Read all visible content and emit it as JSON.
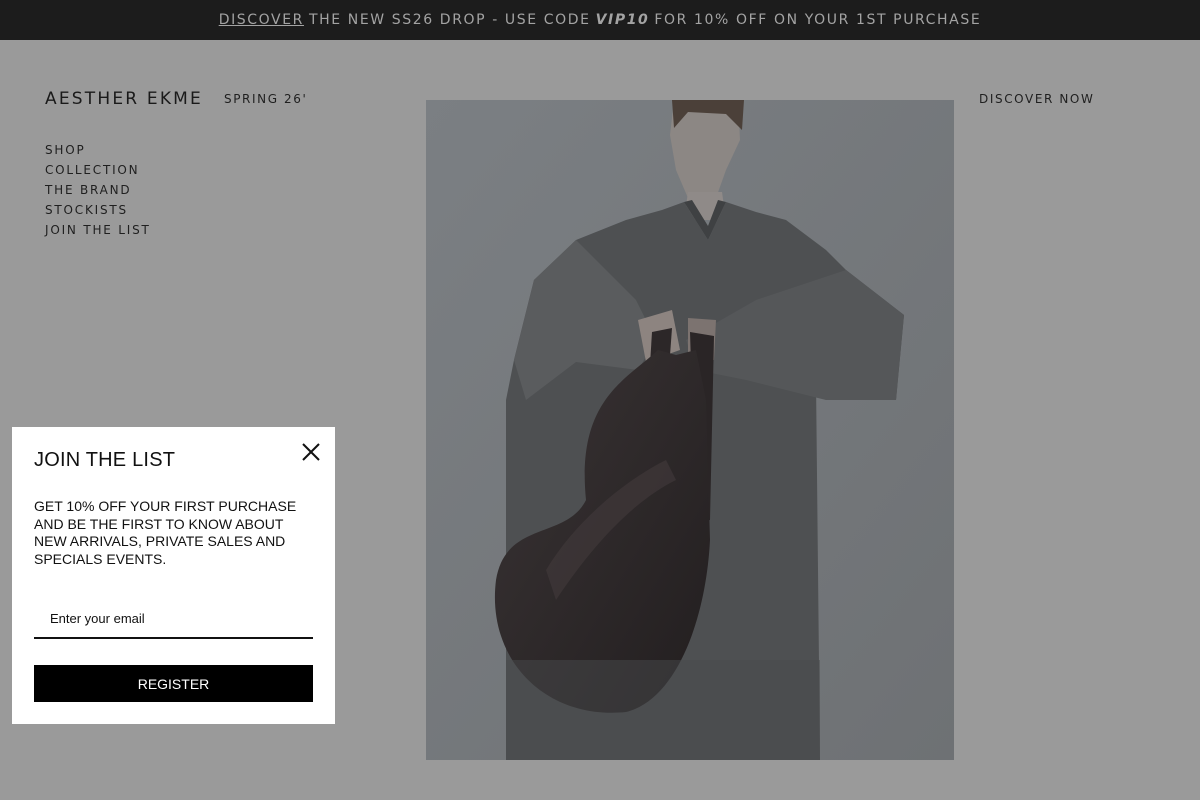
{
  "announcement": {
    "link_text": "DISCOVER",
    "text_before_code": "THE NEW SS26 DROP - USE CODE",
    "code": "VIP10",
    "text_after_code": "FOR 10% OFF ON YOUR 1ST PURCHASE"
  },
  "header": {
    "logo": "AESTHER EKME",
    "season": "SPRING 26'",
    "cta": "DISCOVER NOW"
  },
  "nav": {
    "items": [
      {
        "label": "SHOP"
      },
      {
        "label": "COLLECTION"
      },
      {
        "label": "THE BRAND"
      },
      {
        "label": "STOCKISTS"
      },
      {
        "label": "JOIN THE LIST"
      }
    ]
  },
  "modal": {
    "title": "JOIN THE LIST",
    "body": "GET 10% OFF YOUR FIRST PURCHASE AND BE THE FIRST TO KNOW ABOUT NEW ARRIVALS, PRIVATE SALES AND SPECIALS EVENTS.",
    "email_placeholder": "Enter your email",
    "email_value": "",
    "register_label": "REGISTER",
    "close_icon": "close-icon"
  },
  "colors": {
    "announcement_bg": "#1c1c1c",
    "overlay_bg": "#9a9a9a",
    "button_bg": "#000000"
  }
}
